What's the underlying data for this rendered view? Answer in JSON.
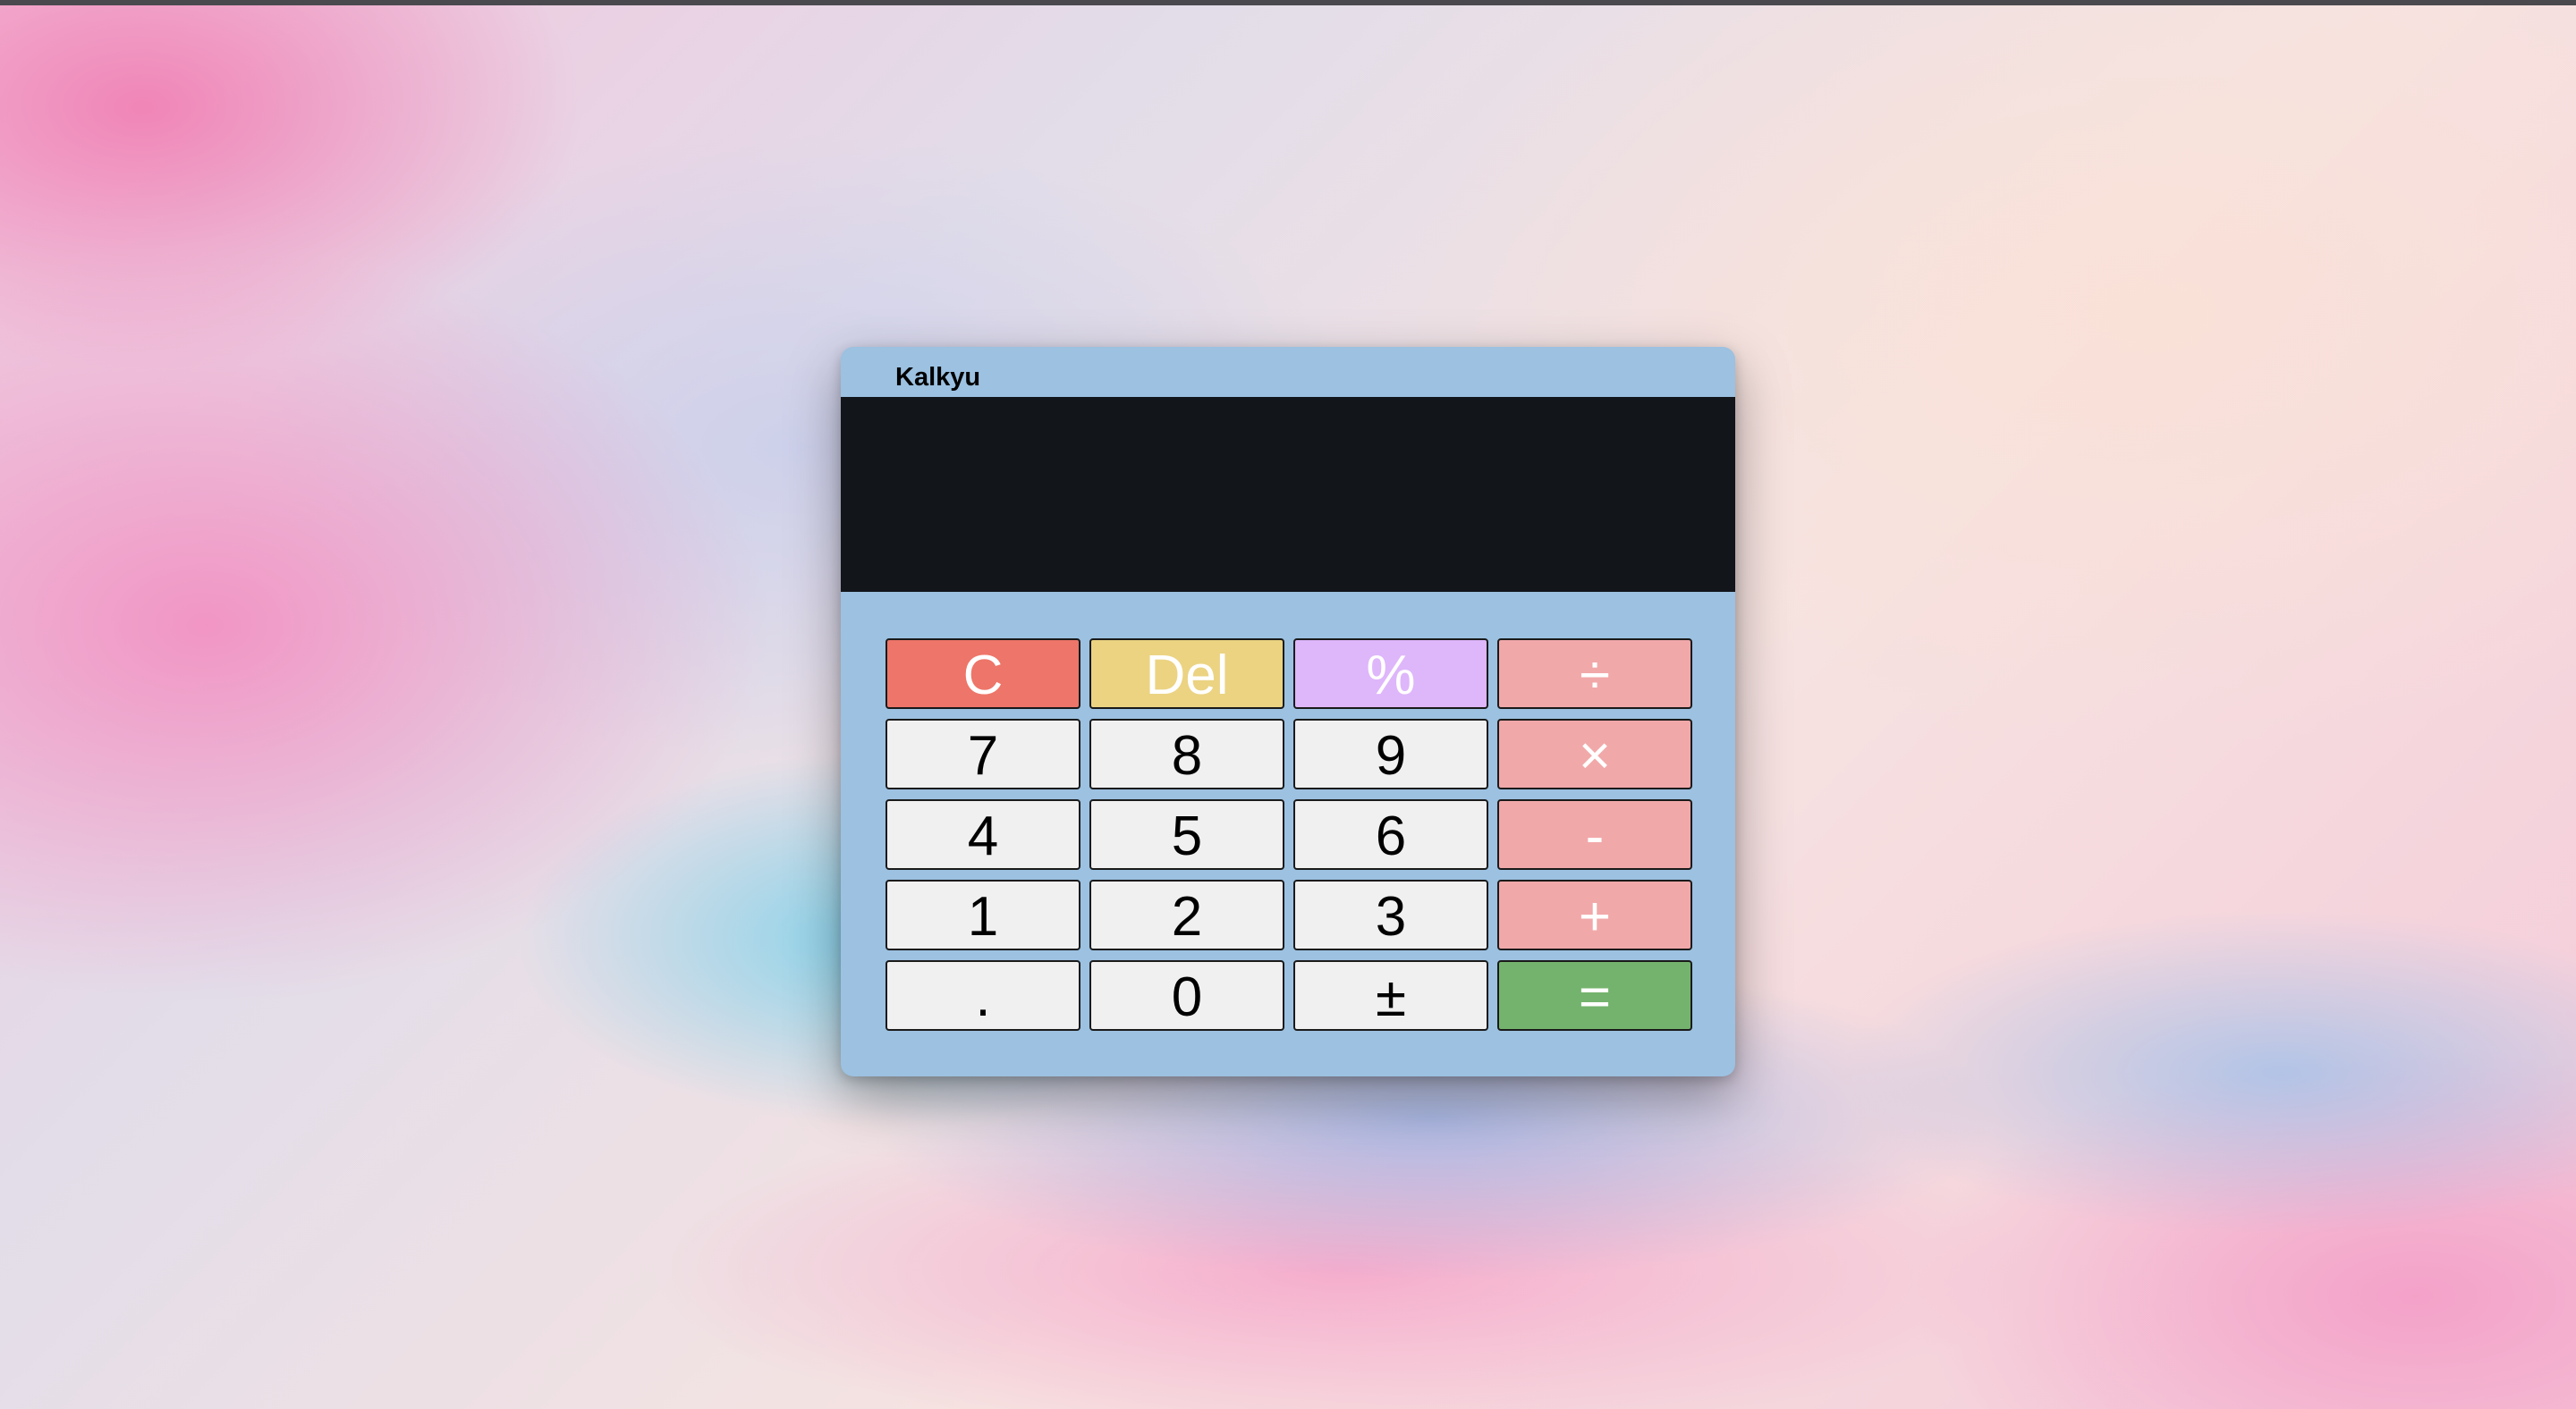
{
  "app": {
    "title": "Kalkyu"
  },
  "display": {
    "value": ""
  },
  "keys": {
    "clear": "C",
    "delete": "Del",
    "percent": "%",
    "divide": "÷",
    "seven": "7",
    "eight": "8",
    "nine": "9",
    "multiply": "×",
    "four": "4",
    "five": "5",
    "six": "6",
    "subtract": "-",
    "one": "1",
    "two": "2",
    "three": "3",
    "add": "+",
    "decimal": ".",
    "zero": "0",
    "negate": "±",
    "equals": "="
  },
  "colors": {
    "window": "#9cc1e1",
    "display": "#12151a",
    "clear": "#ee7569",
    "delete": "#ebd382",
    "percent": "#deb6fa",
    "operator": "#f1a8a9",
    "equals": "#74b36d",
    "digit": "#f0f0f0"
  }
}
